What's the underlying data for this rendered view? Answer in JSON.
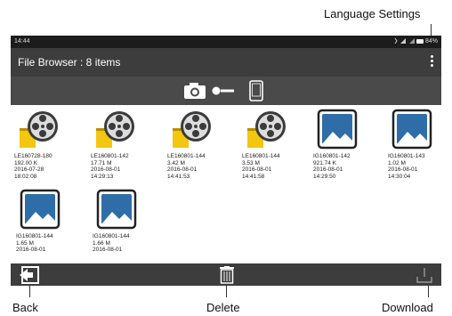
{
  "callouts": {
    "language": "Language Settings",
    "back": "Back",
    "delete": "Delete",
    "download": "Download"
  },
  "status": {
    "time": "14:44",
    "battery": "84%"
  },
  "appbar": {
    "title": "File Browser : 8 items"
  },
  "files": [
    {
      "type": "video",
      "name": "LE160728-180",
      "size": "192.00 K",
      "date": "2016-07-28",
      "time": "18:02:08"
    },
    {
      "type": "video",
      "name": "LE160801-142",
      "size": "17.71 M",
      "date": "2016-08-01",
      "time": "14:29:13"
    },
    {
      "type": "video",
      "name": "LE160801-144",
      "size": "3.42 M",
      "date": "2016-08-01",
      "time": "14:41:53"
    },
    {
      "type": "video",
      "name": "LE160801-144",
      "size": "3.53 M",
      "date": "2016-08-01",
      "time": "14:41:58"
    },
    {
      "type": "photo",
      "name": "IG160801-142",
      "size": "921.74 K",
      "date": "2016-08-01",
      "time": "14:29:50"
    },
    {
      "type": "photo",
      "name": "IG160801-143",
      "size": "1.02 M",
      "date": "2016-08-01",
      "time": "14:30:04"
    },
    {
      "type": "photo",
      "name": "IG160801-144",
      "size": "1.65 M",
      "date": "2016-08-01",
      "time": ""
    },
    {
      "type": "photo",
      "name": "IG160801-144",
      "size": "1.66 M",
      "date": "2016-08-01",
      "time": ""
    }
  ],
  "colors": {
    "film": "#f3c60f",
    "reel": "#3b3b3b",
    "photo": "#2f6da8"
  }
}
